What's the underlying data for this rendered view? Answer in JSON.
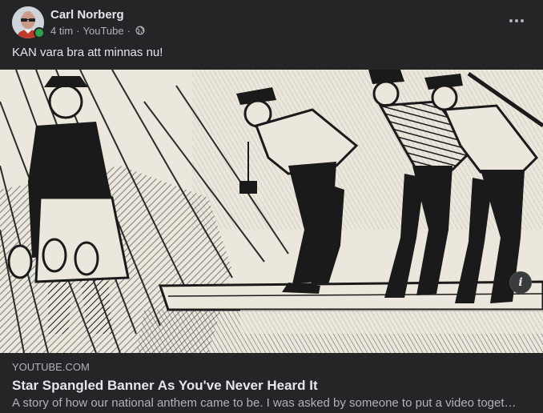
{
  "post": {
    "author": {
      "name": "Carl Norberg",
      "online": true,
      "online_color": "#31a24c"
    },
    "meta": {
      "time": "4 tim",
      "separator": "·",
      "source": "YouTube",
      "privacy_icon": "globe-icon"
    },
    "more_icon": "more-options-icon",
    "caption": "KAN vara bra att minnas nu!",
    "media": {
      "info_icon": "i"
    },
    "link_preview": {
      "domain": "YOUTUBE.COM",
      "title": "Star Spangled Banner As You've Never Heard It",
      "description": "A story of how our national anthem came to be. I was asked by someone to put a video together"
    }
  },
  "colors": {
    "background": "#242526",
    "primary_text": "#e4e6eb",
    "secondary_text": "#b0b3b8"
  }
}
